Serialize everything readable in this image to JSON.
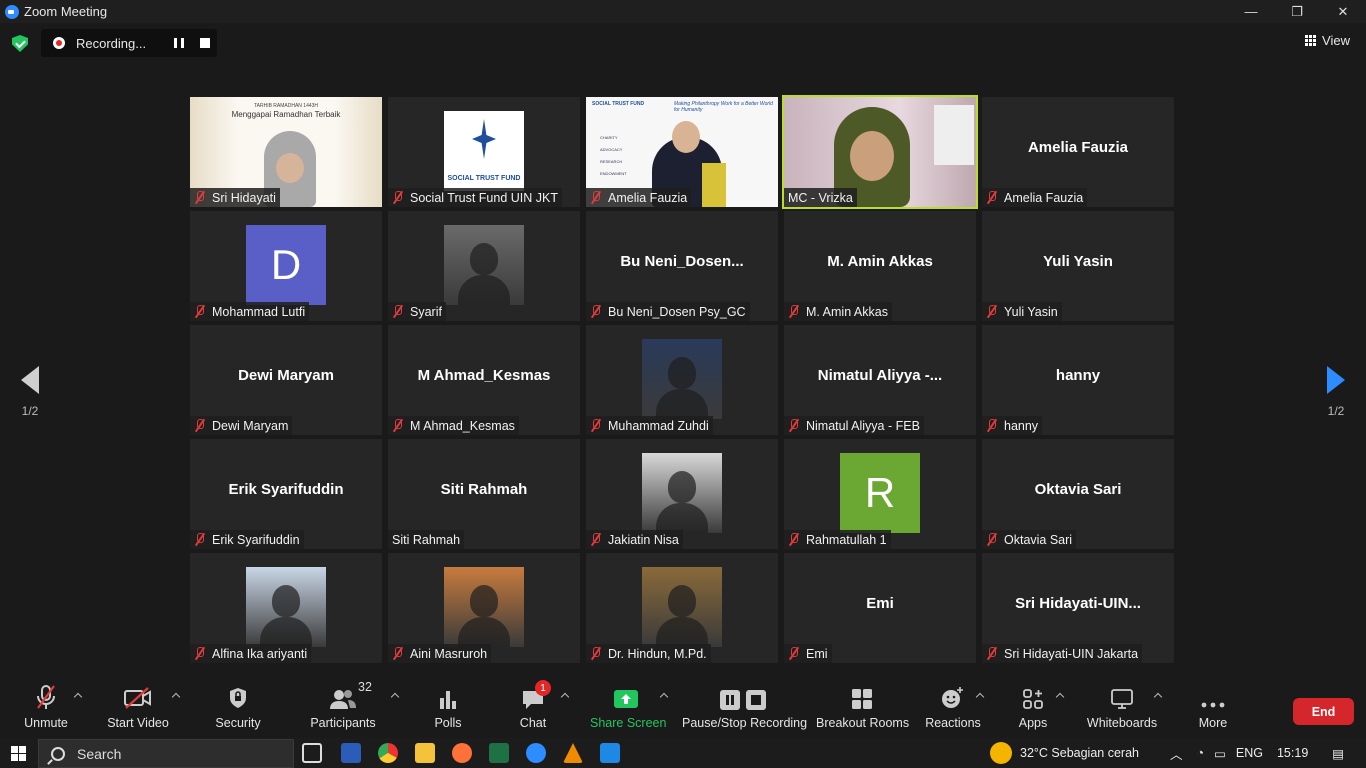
{
  "window": {
    "title": "Zoom Meeting",
    "minimize": "—",
    "restore": "❐",
    "close": "✕"
  },
  "recording": {
    "label": "Recording..."
  },
  "view": {
    "label": "View"
  },
  "pager": {
    "left": "1/2",
    "right": "1/2"
  },
  "participants": [
    {
      "label": "Sri Hidayati",
      "bigname": "",
      "kind": "video-slide",
      "muted": true,
      "active": false
    },
    {
      "label": "Social Trust Fund UIN JKT",
      "bigname": "",
      "kind": "video-logo",
      "muted": true,
      "active": false
    },
    {
      "label": "Amelia Fauzia",
      "bigname": "",
      "kind": "video-slide2",
      "muted": true,
      "active": false
    },
    {
      "label": "MC - Vrizka",
      "bigname": "",
      "kind": "video-cam",
      "muted": false,
      "active": true
    },
    {
      "label": "Amelia Fauzia",
      "bigname": "Amelia Fauzia",
      "kind": "name",
      "muted": true,
      "active": false
    },
    {
      "label": "Mohammad Lutfi",
      "bigname": "",
      "kind": "letter",
      "letter": "D",
      "letter_color": "#5a5fc8",
      "muted": true,
      "active": false
    },
    {
      "label": "Syarif",
      "bigname": "",
      "kind": "photo",
      "photo_color": "#6a6a6a",
      "muted": true,
      "active": false
    },
    {
      "label": "Bu Neni_Dosen Psy_GC",
      "bigname": "Bu  Neni_Dosen...",
      "kind": "name",
      "muted": true,
      "active": false
    },
    {
      "label": "M. Amin Akkas",
      "bigname": "M. Amin Akkas",
      "kind": "name",
      "muted": true,
      "active": false
    },
    {
      "label": "Yuli Yasin",
      "bigname": "Yuli Yasin",
      "kind": "name",
      "muted": true,
      "active": false
    },
    {
      "label": "Dewi Maryam",
      "bigname": "Dewi Maryam",
      "kind": "name",
      "muted": true,
      "active": false
    },
    {
      "label": "M Ahmad_Kesmas",
      "bigname": "M Ahmad_Kesmas",
      "kind": "name",
      "muted": true,
      "active": false
    },
    {
      "label": "Muhammad Zuhdi",
      "bigname": "",
      "kind": "photo",
      "photo_color": "#2a3a5a",
      "muted": true,
      "active": false
    },
    {
      "label": "Nimatul Aliyya - FEB",
      "bigname": "Nimatul  Aliyya  -...",
      "kind": "name",
      "muted": true,
      "active": false
    },
    {
      "label": "hanny",
      "bigname": "hanny",
      "kind": "name",
      "muted": true,
      "active": false
    },
    {
      "label": "Erik Syarifuddin",
      "bigname": "Erik Syarifuddin",
      "kind": "name",
      "muted": true,
      "active": false
    },
    {
      "label": "Siti Rahmah",
      "bigname": "Siti Rahmah",
      "kind": "name",
      "muted": false,
      "active": false
    },
    {
      "label": "Jakiatin Nisa",
      "bigname": "",
      "kind": "photo",
      "photo_color": "#d8d8d8",
      "muted": true,
      "active": false
    },
    {
      "label": "Rahmatullah 1",
      "bigname": "",
      "kind": "letter",
      "letter": "R",
      "letter_color": "#6aa833",
      "muted": true,
      "active": false
    },
    {
      "label": "Oktavia Sari",
      "bigname": "Oktavia Sari",
      "kind": "name",
      "muted": true,
      "active": false
    },
    {
      "label": "Alfina Ika ariyanti",
      "bigname": "",
      "kind": "photo",
      "photo_color": "#c9d6e6",
      "muted": true,
      "active": false
    },
    {
      "label": "Aini Masruroh",
      "bigname": "",
      "kind": "photo",
      "photo_color": "#c77b3e",
      "muted": true,
      "active": false
    },
    {
      "label": "Dr. Hindun, M.Pd.",
      "bigname": "",
      "kind": "photo",
      "photo_color": "#8a6a3a",
      "muted": true,
      "active": false
    },
    {
      "label": "Emi",
      "bigname": "Emi",
      "kind": "name",
      "muted": true,
      "active": false
    },
    {
      "label": "Sri Hidayati-UIN Jakarta",
      "bigname": "Sri  Hidayati-UIN...",
      "kind": "name",
      "muted": true,
      "active": false
    }
  ],
  "slide_texts": {
    "slide1_top": "TARHIB RAMADHAN 1443H",
    "slide1_title": "Menggapai Ramadhan Terbaik",
    "logo_text": "SOCIAL TRUST FUND",
    "slide2_brand": "SOCIAL TRUST FUND",
    "slide2_tagline": "Making Philanthropy Work for a Better World for Humanity",
    "slide2_items": [
      "CHARITY",
      "ADVOCACY",
      "RESEARCH",
      "ENDOWMENT"
    ]
  },
  "toolbar": {
    "unmute": "Unmute",
    "start_video": "Start Video",
    "security": "Security",
    "participants": "Participants",
    "participants_count": "32",
    "polls": "Polls",
    "chat": "Chat",
    "chat_badge": "1",
    "share_screen": "Share Screen",
    "pause_stop_recording": "Pause/Stop Recording",
    "breakout_rooms": "Breakout Rooms",
    "reactions": "Reactions",
    "apps": "Apps",
    "whiteboards": "Whiteboards",
    "more": "More",
    "end": "End"
  },
  "taskbar": {
    "search": "Search",
    "weather": "32°C  Sebagian cerah",
    "lang": "ENG",
    "time": "15:19"
  },
  "colors": {
    "active_border": "#b8dd2a",
    "share_green": "#23c55e",
    "end_red": "#d4262b",
    "accent_blue": "#2d8cff"
  }
}
